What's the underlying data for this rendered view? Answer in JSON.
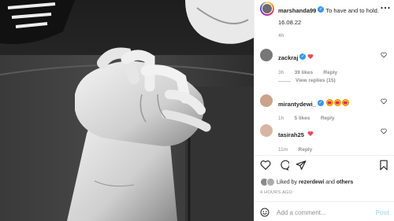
{
  "post": {
    "username": "marshanda99",
    "caption": "To have and to hold.",
    "date": "16.08.22",
    "time": "4h"
  },
  "comments": [
    {
      "username": "zackraj",
      "time": "3h",
      "likes": "39 likes",
      "reply": "Reply",
      "view_replies": "View replies (15)"
    },
    {
      "username": "mirantydewi_",
      "time": "1h",
      "likes": "5 likes",
      "reply": "Reply"
    },
    {
      "username": "tasirah25",
      "time": "11m",
      "reply": "Reply"
    }
  ],
  "liked_by": {
    "prefix": "Liked by",
    "user": "rezerdewi",
    "and": "and",
    "others": "others"
  },
  "time_ago": "4 HOURS AGO",
  "comment_box": {
    "placeholder": "Add a comment...",
    "post_label": "Post"
  },
  "icons": {
    "more": "more-dots-icon",
    "heart": "heart-icon",
    "comment": "comment-icon",
    "share": "share-icon",
    "save": "bookmark-icon",
    "emoji": "emoji-icon"
  },
  "colors": {
    "verified": "#3897f0",
    "heart": "#ed4956",
    "muted": "#8e8e8e",
    "post_button": "#b3dbff"
  }
}
